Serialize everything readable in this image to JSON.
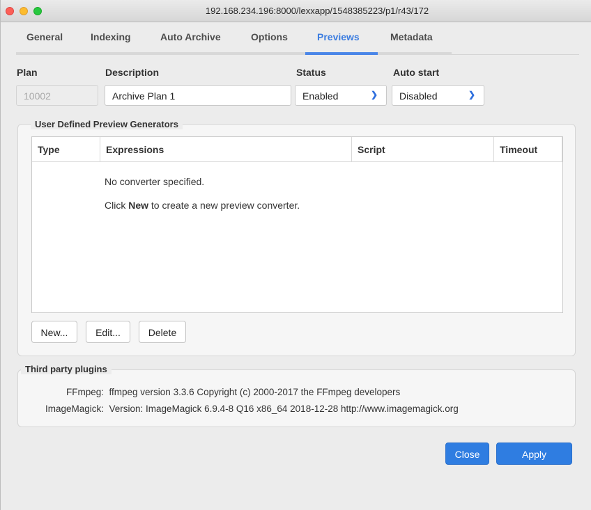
{
  "window": {
    "title": "192.168.234.196:8000/lexxapp/1548385223/p1/r43/172"
  },
  "tabs": [
    {
      "label": "General"
    },
    {
      "label": "Indexing"
    },
    {
      "label": "Auto Archive"
    },
    {
      "label": "Options"
    },
    {
      "label": "Previews",
      "active": true
    },
    {
      "label": "Metadata"
    }
  ],
  "form": {
    "plan_label": "Plan",
    "plan_value": "10002",
    "description_label": "Description",
    "description_value": "Archive Plan  1",
    "status_label": "Status",
    "status_value": "Enabled",
    "autostart_label": "Auto start",
    "autostart_value": "Disabled"
  },
  "generators": {
    "title": "User Defined Preview Generators",
    "columns": [
      "Type",
      "Expressions",
      "Script",
      "Timeout"
    ],
    "empty_line1": "No converter specified.",
    "empty_line2_prefix": "Click ",
    "empty_line2_bold": "New",
    "empty_line2_suffix": " to create a new preview converter.",
    "buttons": {
      "new": "New...",
      "edit": "Edit...",
      "delete": "Delete"
    }
  },
  "plugins": {
    "title": "Third party plugins",
    "rows": [
      {
        "name": "FFmpeg:",
        "value": "ffmpeg version 3.3.6 Copyright (c) 2000-2017 the FFmpeg developers"
      },
      {
        "name": "ImageMagick:",
        "value": "Version: ImageMagick 6.9.4-8 Q16 x86_64 2018-12-28 http://www.imagemagick.org"
      }
    ]
  },
  "footer": {
    "close": "Close",
    "apply": "Apply"
  },
  "colors": {
    "accent": "#2f7de1",
    "tab_active": "#3c7de0"
  }
}
